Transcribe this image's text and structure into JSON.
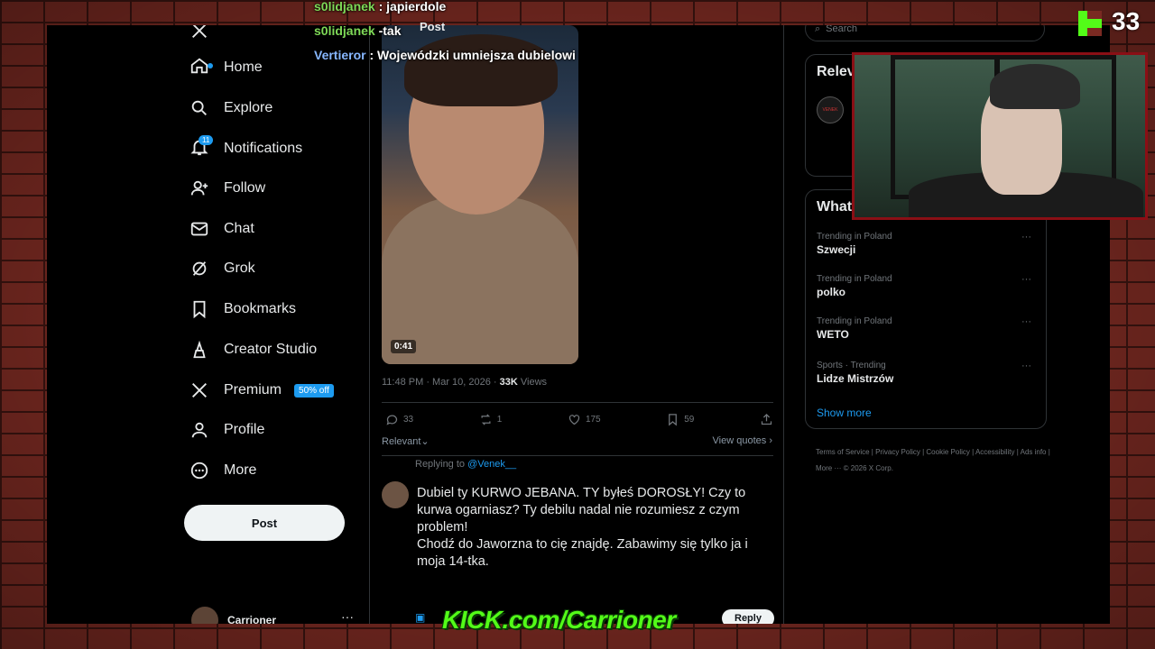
{
  "nav": {
    "items": [
      {
        "label": "Home",
        "icon": "home-icon"
      },
      {
        "label": "Explore",
        "icon": "search-icon"
      },
      {
        "label": "Notifications",
        "icon": "bell-icon",
        "badge": "11"
      },
      {
        "label": "Follow",
        "icon": "person-add-icon"
      },
      {
        "label": "Chat",
        "icon": "mail-icon"
      },
      {
        "label": "Grok",
        "icon": "grok-icon"
      },
      {
        "label": "Bookmarks",
        "icon": "bookmark-icon"
      },
      {
        "label": "Creator Studio",
        "icon": "creator-studio-icon"
      },
      {
        "label": "Premium",
        "icon": "x-logo-icon",
        "badge": "50% off"
      },
      {
        "label": "Profile",
        "icon": "profile-icon"
      },
      {
        "label": "More",
        "icon": "more-circle-icon"
      }
    ],
    "post_label": "Post",
    "user_name": "Carrioner",
    "user_more": "···"
  },
  "post": {
    "top_label": "Post",
    "video_duration": "0:41",
    "time": "11:48 PM · Mar 10, 2026 · ",
    "views": "33K",
    "views_label": " Views",
    "replies": "33",
    "reposts": "1",
    "likes": "175",
    "bookmarks": "59",
    "sort_label": "Relevant",
    "view_quotes": "View quotes"
  },
  "reply": {
    "replying_prefix": "Replying to ",
    "replying_handle": "@Venek__",
    "text_1": "Dubiel ty KURWO JEBANA. TY byłeś DOROSŁY! Czy to kurwa ogarniasz? Ty debilu nadal nie rozumiesz z czym problem!",
    "text_2": "Chodź do Jaworzna to cię znajdę. Zabawimy się tylko ja i moja 14-tka.",
    "reply_button": "Reply"
  },
  "right": {
    "search_placeholder": "Search",
    "relevant_title": "Relev",
    "venek_logo_text": "VENEK",
    "whats_happening_title": "What",
    "trends": [
      {
        "meta": "Trending in Poland",
        "name": "Szwecji"
      },
      {
        "meta": "Trending in Poland",
        "name": "polko"
      },
      {
        "meta": "Trending in Poland",
        "name": "WETO"
      },
      {
        "meta": "Sports · Trending",
        "name": "Lidze Mistrzów"
      }
    ],
    "show_more": "Show more",
    "footer": "Terms of Service  |  Privacy Policy  |  Cookie Policy  |  Accessibility  |  Ads info  |  More ···  © 2026 X Corp."
  },
  "overlay": {
    "chat": [
      {
        "user": "s0lidjanek",
        "message": "japierdole"
      },
      {
        "user": "s0lidjanek",
        "message": "-tak"
      },
      {
        "user": "Vertieror",
        "message": "Wojewódzki umniejsza dubielowi"
      }
    ],
    "viewer_count": "33",
    "kick_banner": "KICK.com/Carrioner"
  },
  "colors": {
    "accent": "#1d9bf0",
    "kick_green": "#53fc18",
    "background": "#000000"
  }
}
